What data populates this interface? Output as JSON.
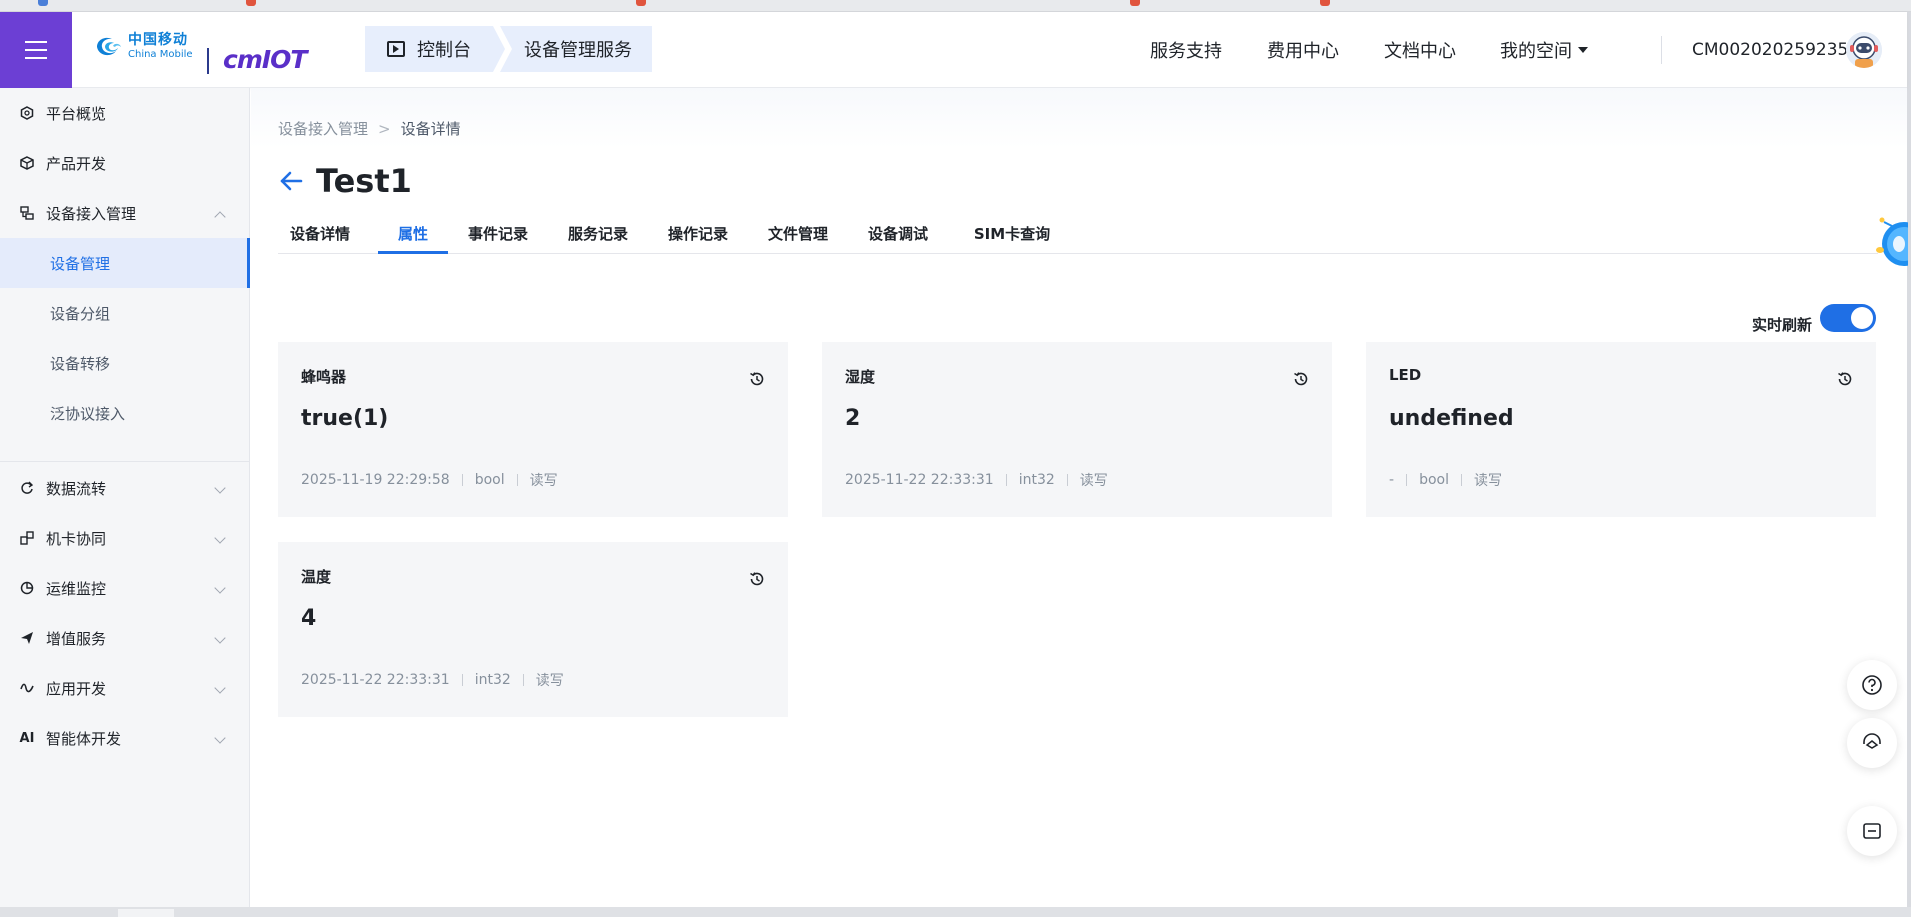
{
  "header": {
    "logo_cn": "中国移动",
    "logo_en": "China Mobile",
    "brand": "cmIOT",
    "console_label": "控制台",
    "service_label": "设备管理服务",
    "nav": [
      "服务支持",
      "费用中心",
      "文档中心",
      "我的空间"
    ],
    "account": "CM002020259235",
    "accent": "#6c3fd4"
  },
  "sidebar": {
    "items": [
      {
        "label": "平台概览",
        "icon": "hexagon-icon"
      },
      {
        "label": "产品开发",
        "icon": "cube-icon"
      },
      {
        "label": "设备接入管理",
        "icon": "device-icon"
      },
      {
        "label": "数据流转",
        "icon": "flow-icon"
      },
      {
        "label": "机卡协同",
        "icon": "link-icon"
      },
      {
        "label": "运维监控",
        "icon": "pie-icon"
      },
      {
        "label": "增值服务",
        "icon": "send-icon"
      },
      {
        "label": "应用开发",
        "icon": "wave-icon"
      },
      {
        "label": "智能体开发",
        "icon": "ai-icon"
      }
    ],
    "sub_items": [
      "设备管理",
      "设备分组",
      "设备转移",
      "泛协议接入"
    ],
    "active_sub": "设备管理",
    "ai_badge": "AI"
  },
  "main": {
    "breadcrumb": [
      "设备接入管理",
      ">",
      "设备详情"
    ],
    "title": "Test1",
    "tabs": [
      "设备详情",
      "属性",
      "事件记录",
      "服务记录",
      "操作记录",
      "文件管理",
      "设备调试",
      "SIM卡查询"
    ],
    "active_tab": "属性",
    "refresh_label": "实时刷新",
    "refresh_on": true,
    "cards": [
      {
        "name": "蜂鸣器",
        "value": "true(1)",
        "time": "2025-11-19 22:29:58",
        "type": "bool",
        "access": "读写"
      },
      {
        "name": "湿度",
        "value": "2",
        "time": "2025-11-22 22:33:31",
        "type": "int32",
        "access": "读写"
      },
      {
        "name": "LED",
        "value": "undefined",
        "time": "-",
        "type": "bool",
        "access": "读写"
      },
      {
        "name": "温度",
        "value": "4",
        "time": "2025-11-22 22:33:31",
        "type": "int32",
        "access": "读写"
      }
    ]
  },
  "float_buttons": [
    "help-icon",
    "service-icon",
    "collapse-icon"
  ],
  "colors": {
    "primary": "#1f6fe5",
    "brand_purple": "#6c3fd4",
    "card_bg": "#f5f6f8"
  }
}
